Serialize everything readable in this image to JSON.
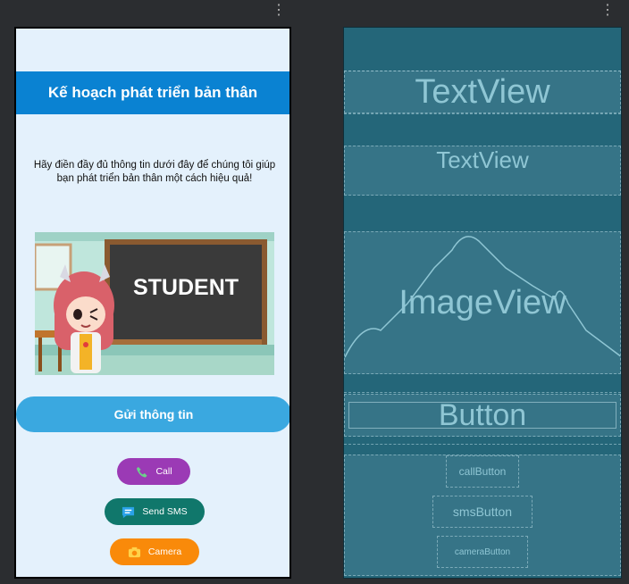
{
  "design": {
    "title": "Kế hoạch phát triển bản thân",
    "description": "Hãy điền đầy đủ thông tin dưới đây để chúng tôi giúp bạn phát triển bản thân một cách hiệu quả!",
    "chalkboard_text": "STUDENT",
    "send_button": "Gửi thông tin",
    "call_button": "Call",
    "sms_button": "Send SMS",
    "camera_button": "Camera",
    "colors": {
      "background": "#e4f1fc",
      "title_bar": "#0a82d2",
      "send_button": "#3aa8e0",
      "call_button": "#9b3ab5",
      "sms_button": "#10776b",
      "camera_button": "#f98a0a"
    },
    "icons": [
      "phone-icon",
      "message-icon",
      "camera-icon"
    ]
  },
  "blueprint": {
    "title_label": "TextView",
    "desc_label": "TextView",
    "image_label": "ImageView",
    "button_label": "Button",
    "call_label": "callButton",
    "sms_label": "smsButton",
    "camera_label": "cameraButton",
    "color": "#246679"
  },
  "toolbar": {
    "overflow_icon": "more-vert-icon"
  }
}
